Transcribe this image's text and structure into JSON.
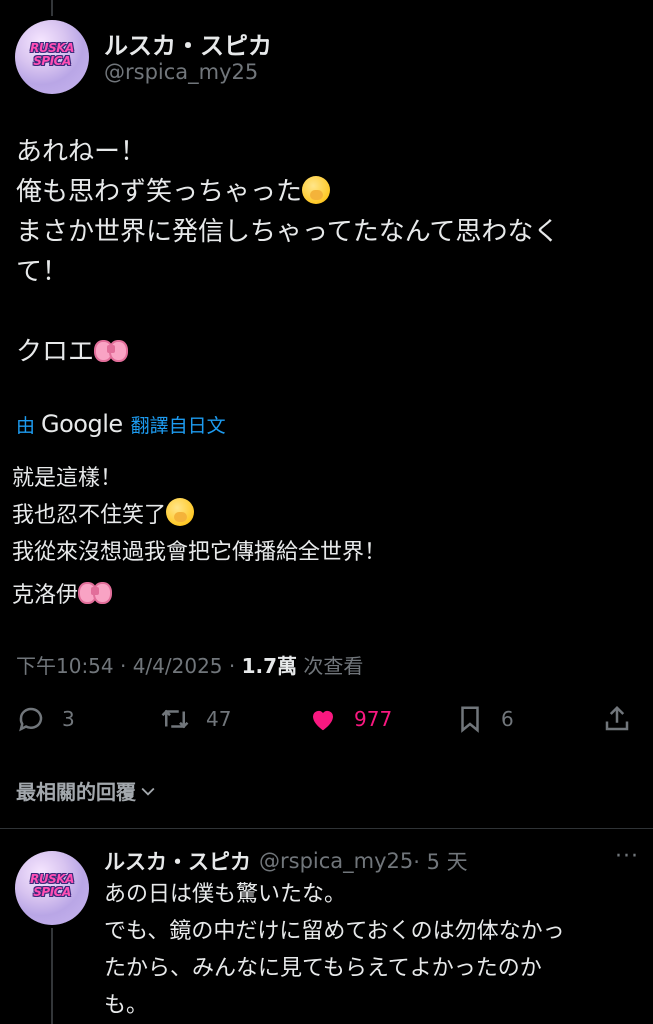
{
  "post": {
    "author_name": "ルスカ・スピカ",
    "author_handle": "@rspica_my25",
    "avatar_logo": "RUSKA SPICA",
    "text_lines": [
      "あれねー！",
      "俺も思わず笑っちゃった",
      "まさか世界に発信しちゃってたなんて思わなく",
      "て！",
      "",
      "クロエ"
    ],
    "translation_prefix": "由",
    "translation_brand": "Google",
    "translation_suffix": "翻譯自日文",
    "translated_lines": [
      "就是這樣！",
      "我也忍不住笑了",
      "我從來沒想過我會把它傳播給全世界！",
      "",
      "克洛伊"
    ],
    "time": "下午10:54 · 4/4/2025 · ",
    "views_count": "1.7萬",
    "views_label": " 次查看",
    "actions": {
      "replies": "3",
      "reposts": "47",
      "likes": "977",
      "bookmarks": "6"
    }
  },
  "replies_sort_label": "最相關的回覆",
  "reply": {
    "author_name": "ルスカ・スピカ",
    "author_handle": "@rspica_my25",
    "age": "· 5 天",
    "more": "···",
    "text": "あの日は僕も驚いたな。\nでも、鏡の中だけに留めておくのは勿体なかっ\nたから、みんなに見てもらえてよかったのか\nも。"
  },
  "colors": {
    "background": "#000000",
    "text": "#e7e9ea",
    "secondary": "#71767b",
    "link": "#1d9bf0",
    "like": "#f91880"
  }
}
